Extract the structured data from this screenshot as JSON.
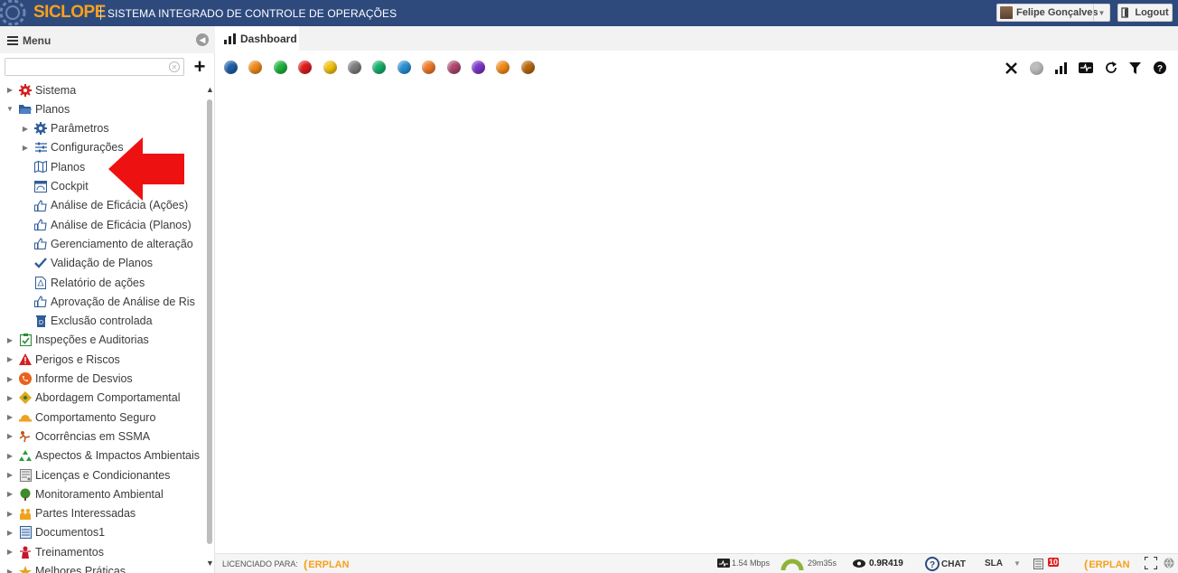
{
  "app": {
    "logo": "SICLOPE",
    "system_title": "SISTEMA INTEGRADO DE CONTROLE DE OPERAÇÕES",
    "user_name": "Felipe Gonçalves",
    "logout_label": "Logout"
  },
  "sidebar": {
    "menu_title": "Menu",
    "search": {
      "value": "",
      "placeholder": ""
    },
    "items": [
      {
        "label": "Sistema",
        "icon": "gear-icon",
        "level": 0,
        "state": "collapsed"
      },
      {
        "label": "Planos",
        "icon": "folder-open-icon",
        "level": 0,
        "state": "expanded"
      },
      {
        "label": "Parâmetros",
        "icon": "gear-icon",
        "level": 1,
        "state": "collapsed"
      },
      {
        "label": "Configurações",
        "icon": "sliders-icon",
        "level": 1,
        "state": "collapsed"
      },
      {
        "label": "Planos",
        "icon": "map-icon",
        "level": 1,
        "state": "leaf"
      },
      {
        "label": "Cockpit",
        "icon": "dashboard-icon",
        "level": 1,
        "state": "leaf"
      },
      {
        "label": "Análise de Eficácia (Ações)",
        "icon": "thumbs-up-icon",
        "level": 1,
        "state": "leaf"
      },
      {
        "label": "Análise de Eficácia (Planos)",
        "icon": "thumbs-up-icon",
        "level": 1,
        "state": "leaf"
      },
      {
        "label": "Gerenciamento de alteração",
        "icon": "thumbs-up-icon",
        "level": 1,
        "state": "leaf"
      },
      {
        "label": "Validação de Planos",
        "icon": "check-icon",
        "level": 1,
        "state": "leaf"
      },
      {
        "label": "Relatório de ações",
        "icon": "pdf-icon",
        "level": 1,
        "state": "leaf"
      },
      {
        "label": "Aprovação de Análise de Ris",
        "icon": "thumbs-up-icon",
        "level": 1,
        "state": "leaf"
      },
      {
        "label": "Exclusão controlada",
        "icon": "trash-icon",
        "level": 1,
        "state": "leaf"
      },
      {
        "label": "Inspeções e Auditorias",
        "icon": "clipboard-check-icon",
        "level": 0,
        "state": "collapsed"
      },
      {
        "label": "Perigos e Riscos",
        "icon": "warning-icon",
        "level": 0,
        "state": "collapsed"
      },
      {
        "label": "Informe de Desvios",
        "icon": "phone-icon",
        "level": 0,
        "state": "collapsed"
      },
      {
        "label": "Abordagem Comportamental",
        "icon": "diamond-icon",
        "level": 0,
        "state": "collapsed"
      },
      {
        "label": "Comportamento Seguro",
        "icon": "hardhat-icon",
        "level": 0,
        "state": "collapsed"
      },
      {
        "label": "Ocorrências em SSMA",
        "icon": "falling-person-icon",
        "level": 0,
        "state": "collapsed"
      },
      {
        "label": "Aspectos & Impactos Ambientais",
        "icon": "recycle-icon",
        "level": 0,
        "state": "collapsed"
      },
      {
        "label": "Licenças e Condicionantes",
        "icon": "document-icon",
        "level": 0,
        "state": "collapsed"
      },
      {
        "label": "Monitoramento Ambiental",
        "icon": "tree-icon",
        "level": 0,
        "state": "collapsed"
      },
      {
        "label": "Partes Interessadas",
        "icon": "people-icon",
        "level": 0,
        "state": "collapsed"
      },
      {
        "label": "Documentos1",
        "icon": "list-doc-icon",
        "level": 0,
        "state": "collapsed"
      },
      {
        "label": "Treinamentos",
        "icon": "teacher-icon",
        "level": 0,
        "state": "collapsed"
      },
      {
        "label": "Melhores Práticas",
        "icon": "star-icon",
        "level": 0,
        "state": "collapsed"
      }
    ]
  },
  "tabs": [
    {
      "label": "Dashboard",
      "icon": "bar-chart-icon",
      "active": true
    }
  ],
  "dashboard": {
    "filter_dot_colors": [
      "#1f5fa8",
      "#f08a1c",
      "#1fb33c",
      "#e01c1c",
      "#f3c20f",
      "#7d7d7d",
      "#16b06a",
      "#2a8fd6",
      "#f07a2a",
      "#b0476e",
      "#7c35c9",
      "#f58a17",
      "#b8680f"
    ],
    "toolbar_icons": [
      "close-icon",
      "gray-dot-icon",
      "bar-chart-icon",
      "pulse-icon",
      "refresh-icon",
      "filter-icon",
      "help-icon"
    ]
  },
  "statusbar": {
    "licensed_label": "LICENCIADO PARA:",
    "brand": "ERPLAN",
    "bandwidth": "1.54 Mbps",
    "session_time": "29m35s",
    "version": "0.9R419",
    "chat_label": "CHAT",
    "sla_label": "SLA",
    "notif_count": "10"
  },
  "colors": {
    "topbar": "#2e4a7d",
    "logo": "#f7a11a",
    "arrow": "#ee1111"
  }
}
